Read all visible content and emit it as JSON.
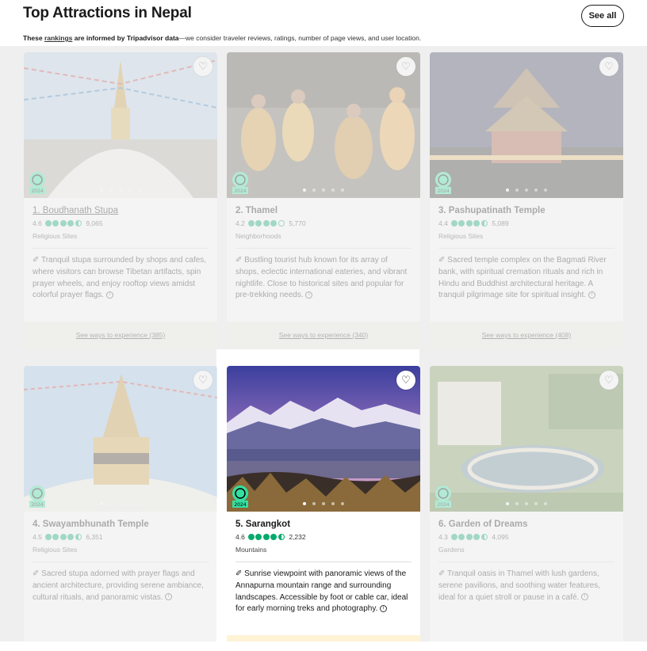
{
  "header": {
    "title": "Top Attractions in Nepal",
    "see_all": "See all",
    "disclaimer": {
      "prefix": "These ",
      "link": "rankings",
      "middle": " are informed by Tripadvisor data",
      "suffix": "—we consider traveler reviews, ratings, number of page views, and user location."
    }
  },
  "badge_year": "2024",
  "cards": [
    {
      "name": "1. Boudhanath Stupa",
      "rating": "4.6",
      "bubbles": 4.5,
      "reviews": "9,065",
      "category": "Religious Sites",
      "description": "Tranquil stupa surrounded by shops and cafes, where visitors can browse Tibetan artifacts, spin prayer wheels, and enjoy rooftop views amidst colorful prayer flags.",
      "ways": "See ways to experience (385)"
    },
    {
      "name": "2. Thamel",
      "rating": "4.2",
      "bubbles": 4,
      "reviews": "5,770",
      "category": "Neighborhoods",
      "description": "Bustling tourist hub known for its array of shops, eclectic international eateries, and vibrant nightlife. Close to historical sites and popular for pre-trekking needs.",
      "ways": "See ways to experience (340)"
    },
    {
      "name": "3. Pashupatinath Temple",
      "rating": "4.4",
      "bubbles": 4.5,
      "reviews": "5,089",
      "category": "Religious Sites",
      "description": "Sacred temple complex on the Bagmati River bank, with spiritual cremation rituals and rich in Hindu and Buddhist architectural heritage. A tranquil pilgrimage site for spiritual insight.",
      "ways": "See ways to experience (408)"
    },
    {
      "name": "4. Swayambhunath Temple",
      "rating": "4.5",
      "bubbles": 4.5,
      "reviews": "6,351",
      "category": "Religious Sites",
      "description": "Sacred stupa adorned with prayer flags and ancient architecture, providing serene ambiance, cultural rituals, and panoramic vistas."
    },
    {
      "name": "5. Sarangkot",
      "rating": "4.6",
      "bubbles": 4.5,
      "reviews": "2,232",
      "category": "Mountains",
      "description": "Sunrise viewpoint with panoramic views of the Annapurna mountain range and surrounding landscapes. Accessible by foot or cable car, ideal for early morning treks and photography."
    },
    {
      "name": "6. Garden of Dreams",
      "rating": "4.3",
      "bubbles": 4.5,
      "reviews": "4,095",
      "category": "Gardens",
      "description": "Tranquil oasis in Thamel with lush gardens, serene pavilions, and soothing water features, ideal for a quiet stroll or pause in a café."
    }
  ]
}
